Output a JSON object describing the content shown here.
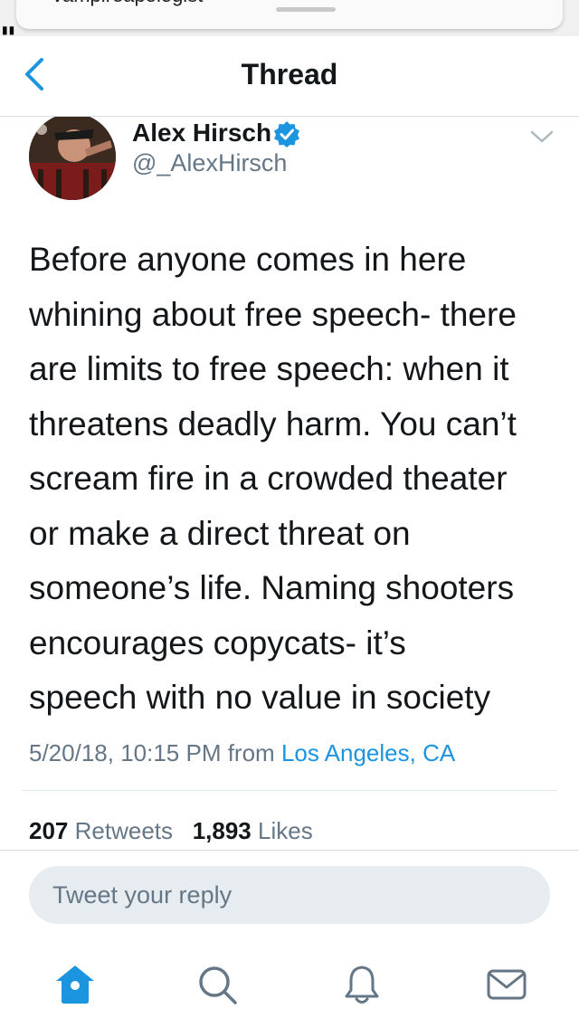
{
  "notification": {
    "text": "vampireapologist"
  },
  "nav": {
    "title": "Thread"
  },
  "tweet": {
    "author_name": "Alex Hirsch",
    "handle": "@_AlexHirsch",
    "lines": [
      "Before anyone comes in here",
      "whining about free speech- there",
      "are limits to free speech: when it",
      "threatens deadly harm. You can’t",
      "scream fire in a crowded theater",
      "or make a direct threat on",
      "someone’s life.  Naming shooters",
      "encourages copycats- it’s",
      "speech with no value in society"
    ],
    "timestamp": "5/20/18, 10:15 PM from",
    "location": "Los Angeles, CA",
    "retweets_count": "207",
    "retweets_label": "Retweets",
    "likes_count": "1,893",
    "likes_label": "Likes"
  },
  "reply": {
    "placeholder": "Tweet your reply"
  },
  "tabs": [
    {
      "name": "home-icon",
      "active": true
    },
    {
      "name": "search-icon",
      "active": false
    },
    {
      "name": "notifications-icon",
      "active": false
    },
    {
      "name": "messages-icon",
      "active": false
    }
  ],
  "colors": {
    "accent": "#1b95e0",
    "text": "#14171a",
    "secondary": "#657786",
    "reply_bg": "#e6ecf0"
  }
}
